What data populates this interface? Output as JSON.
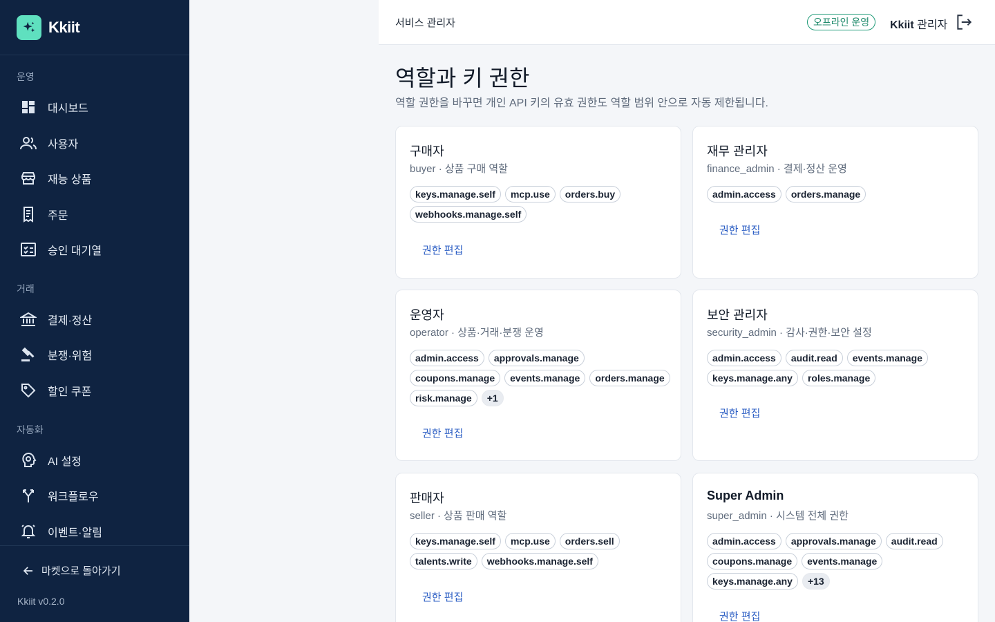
{
  "brand": {
    "name": "Kkiit",
    "logo_icon": "sparkle-icon",
    "accent": "#5fe0bf"
  },
  "sidebar": {
    "sections": [
      "운영",
      "거래",
      "자동화"
    ],
    "items": [
      {
        "label": "대시보드",
        "icon": "dashboard-icon"
      },
      {
        "label": "사용자",
        "icon": "users-icon"
      },
      {
        "label": "재능 상품",
        "icon": "store-icon"
      },
      {
        "label": "주문",
        "icon": "receipt-icon"
      },
      {
        "label": "승인 대기열",
        "icon": "checklist-icon"
      },
      {
        "label": "결제·정산",
        "icon": "bank-icon"
      },
      {
        "label": "분쟁·위험",
        "icon": "gavel-icon"
      },
      {
        "label": "할인 쿠폰",
        "icon": "tag-icon"
      },
      {
        "label": "AI 설정",
        "icon": "ai-brain-icon"
      },
      {
        "label": "워크플로우",
        "icon": "workflow-icon"
      },
      {
        "label": "이벤트·알림",
        "icon": "bell-icon"
      }
    ],
    "back_label": "마켓으로 돌아가기",
    "version": "Kkiit v0.2.0",
    "bg": "#0f2341"
  },
  "topbar": {
    "breadcrumb": "서비스 관리자",
    "status_badge": "오프라인 운영",
    "user_strong": "Kkiit",
    "user_role": " 관리자"
  },
  "page": {
    "title": "역할과 키 권한",
    "subtitle": "역할 권한을 바꾸면 개인 API 키의 유효 권한도 역할 범위 안으로 자동 제한됩니다."
  },
  "roles": [
    {
      "name": "구매자",
      "desc": "buyer · 상품 구매 역할",
      "perms": [
        "keys.manage.self",
        "mcp.use",
        "orders.buy",
        "webhooks.manage.self"
      ],
      "more": "",
      "edit": "권한 편집"
    },
    {
      "name": "재무 관리자",
      "desc": "finance_admin · 결제·정산 운영",
      "perms": [
        "admin.access",
        "orders.manage"
      ],
      "more": "",
      "edit": "권한 편집"
    },
    {
      "name": "운영자",
      "desc": "operator · 상품·거래·분쟁 운영",
      "perms": [
        "admin.access",
        "approvals.manage",
        "coupons.manage",
        "events.manage",
        "orders.manage",
        "risk.manage"
      ],
      "more": "+1",
      "edit": "권한 편집"
    },
    {
      "name": "보안 관리자",
      "desc": "security_admin · 감사·권한·보안 설정",
      "perms": [
        "admin.access",
        "audit.read",
        "events.manage",
        "keys.manage.any",
        "roles.manage"
      ],
      "more": "",
      "edit": "권한 편집"
    },
    {
      "name": "판매자",
      "desc": "seller · 상품 판매 역할",
      "perms": [
        "keys.manage.self",
        "mcp.use",
        "orders.sell",
        "talents.write",
        "webhooks.manage.self"
      ],
      "more": "",
      "edit": "권한 편집"
    },
    {
      "name": "Super Admin",
      "desc": "super_admin · 시스템 전체 권한",
      "perms": [
        "admin.access",
        "approvals.manage",
        "audit.read",
        "coupons.manage",
        "events.manage",
        "keys.manage.any"
      ],
      "more": "+13",
      "edit": "권한 편집"
    }
  ]
}
